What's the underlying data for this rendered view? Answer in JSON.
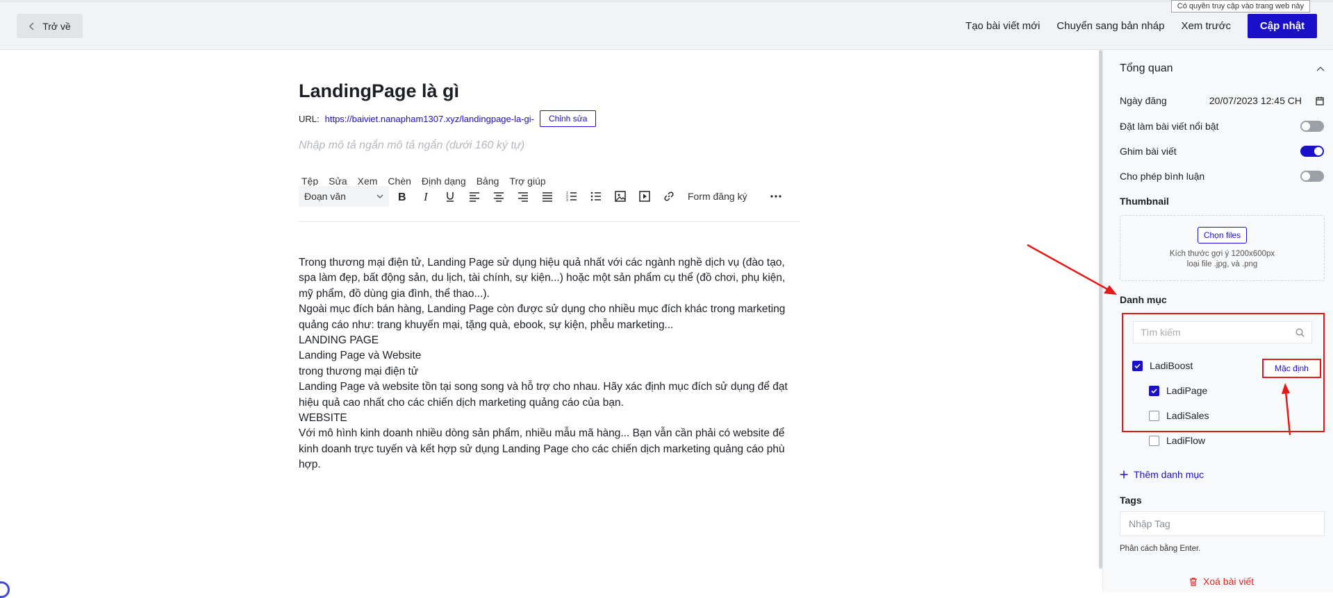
{
  "topbar": {
    "back_label": "Trở về",
    "actions": {
      "new_post": "Tạo bài viết mới",
      "to_draft": "Chuyển sang bản nháp",
      "preview": "Xem trước",
      "update": "Cập nhật"
    },
    "tooltip": "Có quyền truy cập vào trang web này"
  },
  "post": {
    "title": "LandingPage là gì",
    "url_label": "URL:",
    "url": "https://baiviet.nanapham1307.xyz/landingpage-la-gi-",
    "edit_label": "Chỉnh sửa",
    "short_desc_placeholder": "Nhập mô tả ngắn mô tả ngắn (dưới 160 ký tự)"
  },
  "editor": {
    "menu": [
      "Tệp",
      "Sửa",
      "Xem",
      "Chèn",
      "Định dạng",
      "Bảng",
      "Trợ giúp"
    ],
    "format_select": "Đoạn văn",
    "form_label": "Form đăng ký",
    "content": [
      "Trong thương mại điện tử, Landing Page sử dụng hiệu quả nhất với các  ngành nghề dịch vụ (đào tạo, spa làm đẹp, bất động sản, du lịch, tài chính, sự kiện...) hoặc một sản phẩm cụ thể (đồ chơi, phụ kiện, mỹ phẩm, đồ dùng gia đình, thể thao...).",
      "Ngoài mục đích bán hàng, Landing Page còn được sử dụng cho nhiều mục đích khác trong marketing quảng cáo như: trang khuyến mại, tặng quà, ebook, sự kiện, phễu marketing...",
      "LANDING PAGE",
      "Landing Page và Website",
      "trong thương mại điện tử",
      "Landing Page và website tồn tại song song và hỗ trợ cho nhau. Hãy xác định mục đích sử dụng để đạt hiệu quả cao nhất cho các chiến dịch marketing quảng cáo của bạn.",
      "WEBSITE",
      "Với mô hình kinh doanh nhiều dòng sản phẩm, nhiều mẫu mã hàng... Bạn vẫn cần phải có website để kinh doanh trực tuyến và kết hợp sử dụng Landing Page cho các chiến dịch marketing quảng cáo phù hợp."
    ]
  },
  "sidebar": {
    "overview_title": "Tổng quan",
    "publish_date_label": "Ngày đăng",
    "publish_date_value": "20/07/2023 12:45 CH",
    "featured_label": "Đặt làm bài viết nổi bật",
    "featured_on": false,
    "pin_label": "Ghim bài viết",
    "pin_on": true,
    "comments_label": "Cho phép bình luận",
    "comments_on": false,
    "thumbnail_label": "Thumbnail",
    "choose_files": "Chọn files",
    "thumb_hint_1": "Kích thước gợi ý 1200x600px",
    "thumb_hint_2": "loại file .jpg, và .png",
    "category_label": "Danh mục",
    "category_search_placeholder": "Tìm kiếm",
    "categories": [
      {
        "name": "LadiBoost",
        "checked": true
      },
      {
        "name": "LadiPage",
        "checked": true
      },
      {
        "name": "LadiSales",
        "checked": false
      },
      {
        "name": "LadiFlow",
        "checked": false
      }
    ],
    "default_label": "Mặc định",
    "add_category": "Thêm danh mục",
    "tags_label": "Tags",
    "tags_placeholder": "Nhập Tag",
    "tags_hint": "Phân cách bằng Enter.",
    "delete_post": "Xoá bài viết"
  },
  "colors": {
    "accent": "#1b10c9",
    "annotation": "#e61919",
    "danger": "#e02424"
  }
}
